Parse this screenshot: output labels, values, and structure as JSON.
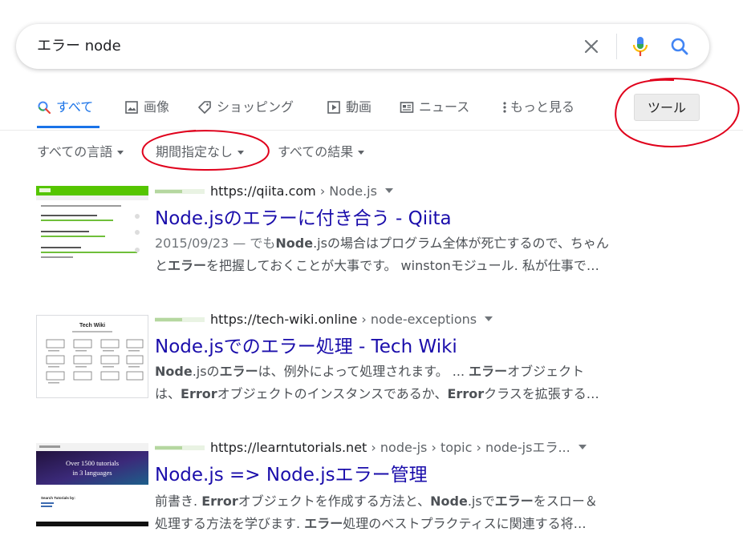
{
  "search": {
    "query": "エラー node"
  },
  "tabs": {
    "all": "すべて",
    "images": "画像",
    "shopping": "ショッピング",
    "videos": "動画",
    "news": "ニュース",
    "more": "もっと見る"
  },
  "tools_button": "ツール",
  "filters": {
    "language": "すべての言語",
    "period": "期間指定なし",
    "results": "すべての結果"
  },
  "results": [
    {
      "url_domain": "https://qiita.com",
      "url_path": " › Node.js",
      "title": "Node.jsのエラーに付き合う - Qiita",
      "snippet_line1": [
        "2015/09/23 — でも",
        "Node",
        ".jsの場合はプログラム全体が死亡するので、ちゃん"
      ],
      "snippet_line2": [
        "と",
        "エラー",
        "を把握しておくことが大事です。 winstonモジュール. 私が仕事で…"
      ]
    },
    {
      "url_domain": "https://tech-wiki.online",
      "url_path": " › node-exceptions",
      "title": "Node.jsでのエラー処理 - Tech Wiki",
      "snippet_line1": [
        "Node",
        ".jsの",
        "エラー",
        "は、例外によって処理されます。 ... ",
        "エラー",
        "オブジェクト"
      ],
      "snippet_line2": [
        "は、",
        "Error",
        "オブジェクトのインスタンスであるか、",
        "Error",
        "クラスを拡張する…"
      ]
    },
    {
      "url_domain": "https://learntutorials.net",
      "url_path": " › node-js › topic › node-jsエラ...",
      "title": "Node.js => Node.jsエラー管理",
      "snippet_line1": [
        "前書き. ",
        "Error",
        "オブジェクトを作成する方法と、",
        "Node",
        ".jsで",
        "エラー",
        "をスロー＆"
      ],
      "snippet_line2": [
        "処理する方法を学びます. ",
        "エラー",
        "処理のベストプラクティスに関連する将…"
      ]
    }
  ],
  "thumbnails": {
    "tech_wiki_title": "Tech Wiki",
    "learntutorials_banner_1": "Over 1500 tutorials",
    "learntutorials_banner_2": "in 3 languages",
    "learntutorials_search": "Search Tutorials by:"
  },
  "colors": {
    "link": "#1a0dab",
    "accent": "#1a73e8",
    "annotation": "#e0001b"
  }
}
